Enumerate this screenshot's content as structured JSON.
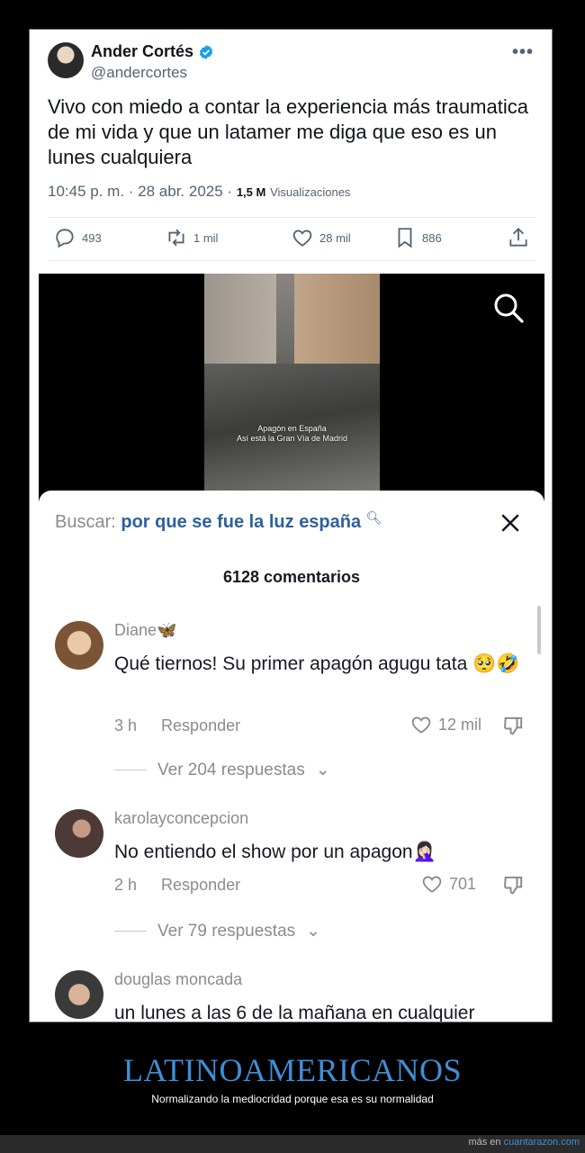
{
  "tweet": {
    "display_name": "Ander Cortés",
    "handle": "@andercortes",
    "text": "Vivo con miedo a contar la experiencia más traumatica de mi vida y que un latamer me diga que eso es un lunes cualquiera",
    "timestamp": "10:45 p. m. · 28 abr. 2025 ·",
    "views_count": "1,5 M",
    "views_label": "Visualizaciones",
    "replies": "493",
    "retweets": "1 mil",
    "likes": "28 mil",
    "bookmarks": "886",
    "verified_color": "#1d9bf0"
  },
  "video": {
    "caption_line1": "Apagón en España",
    "caption_line2": "Así está la Gran Vía de Madrid"
  },
  "comments_sheet": {
    "search_label": "Buscar:",
    "search_query": "por que se fue la luz españa",
    "count_label": "6128 comentarios",
    "comments": [
      {
        "user": "Diane🦋",
        "text": "Qué tiernos! Su primer apagón agugu tata 🥺🤣",
        "time": "3 h",
        "reply_label": "Responder",
        "likes": "12 mil",
        "replies_label": "Ver 204 respuestas"
      },
      {
        "user": "karolayconcepcion",
        "text": "No entiendo el show por un apagon🤦🏻‍♀️",
        "time": "2 h",
        "reply_label": "Responder",
        "likes": "701",
        "replies_label": "Ver 79 respuestas"
      },
      {
        "user": "douglas moncada",
        "text": "un lunes a las 6 de la mañana en cualquier"
      }
    ]
  },
  "footer": {
    "title": "LATINOAMERICANOS",
    "subtitle": "Normalizando la mediocridad porque esa es su normalidad",
    "credit_prefix": "más en",
    "credit_site": "cuantarazon.com"
  }
}
